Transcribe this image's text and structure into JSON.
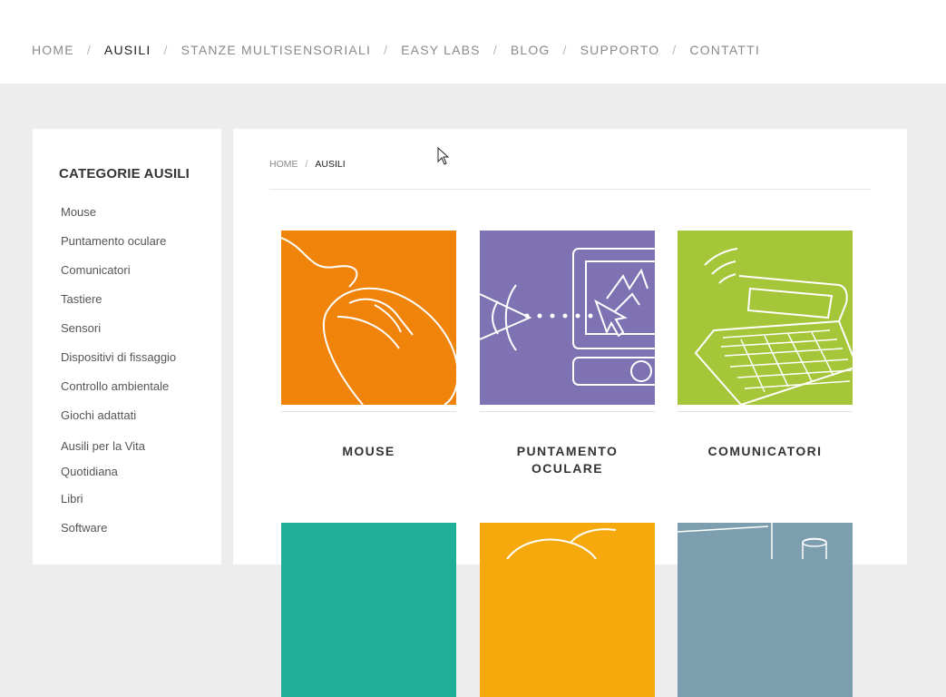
{
  "nav": {
    "items": [
      {
        "label": "HOME",
        "active": false
      },
      {
        "label": "AUSILI",
        "active": true
      },
      {
        "label": "STANZE MULTISENSORIALI",
        "active": false
      },
      {
        "label": "EASY LABS",
        "active": false
      },
      {
        "label": "BLOG",
        "active": false
      },
      {
        "label": "SUPPORTO",
        "active": false
      },
      {
        "label": "CONTATTI",
        "active": false
      }
    ],
    "separator": "/"
  },
  "sidebar": {
    "title": "CATEGORIE AUSILI",
    "items": [
      "Mouse",
      "Puntamento oculare",
      "Comunicatori",
      "Tastiere",
      "Sensori",
      "Dispositivi di fissaggio",
      "Controllo ambientale",
      "Giochi adattati",
      "Ausili per la Vita Quotidiana",
      "Libri",
      "Software"
    ]
  },
  "breadcrumb": {
    "home": "HOME",
    "separator": "/",
    "current": "AUSILI"
  },
  "products": [
    {
      "title": "MOUSE",
      "color": "#f0830a",
      "icon": "mouse-illustration"
    },
    {
      "title": "PUNTAMENTO OCULARE",
      "color": "#7e72b3",
      "icon": "eye-tracking-illustration"
    },
    {
      "title": "COMUNICATORI",
      "color": "#a6c63a",
      "icon": "communicator-illustration"
    },
    {
      "title": "",
      "color": "#1fae98",
      "icon": "keyboard-illustration"
    },
    {
      "title": "",
      "color": "#f6a90c",
      "icon": "sensor-illustration"
    },
    {
      "title": "",
      "color": "#7d9eaf",
      "icon": "mount-illustration"
    }
  ]
}
